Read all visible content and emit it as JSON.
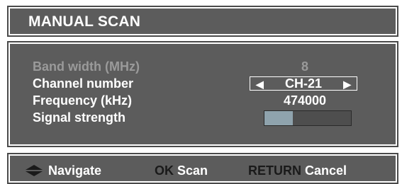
{
  "header": {
    "title": "MANUAL SCAN"
  },
  "settings": {
    "band_width": {
      "label": "Band width (MHz)",
      "value": "8"
    },
    "channel_number": {
      "label": "Channel number",
      "value": "CH-21",
      "left_arrow": "◀",
      "right_arrow": "▶"
    },
    "frequency": {
      "label": "Frequency (kHz)",
      "value": "474000"
    },
    "signal_strength": {
      "label": "Signal strength",
      "level_fraction": 0.33
    }
  },
  "footer": {
    "navigate_label": "Navigate",
    "ok_key": "OK",
    "ok_action": "Scan",
    "return_key": "RETURN",
    "return_action": "Cancel",
    "nav_icon": "up-down-arrows-icon"
  },
  "colors": {
    "panel_bg": "#5c5c5c",
    "text": "#ffffff",
    "disabled_text": "#9a9a9a",
    "key_text": "#1a1a1a",
    "signal_fill": "#8fa3ad"
  }
}
